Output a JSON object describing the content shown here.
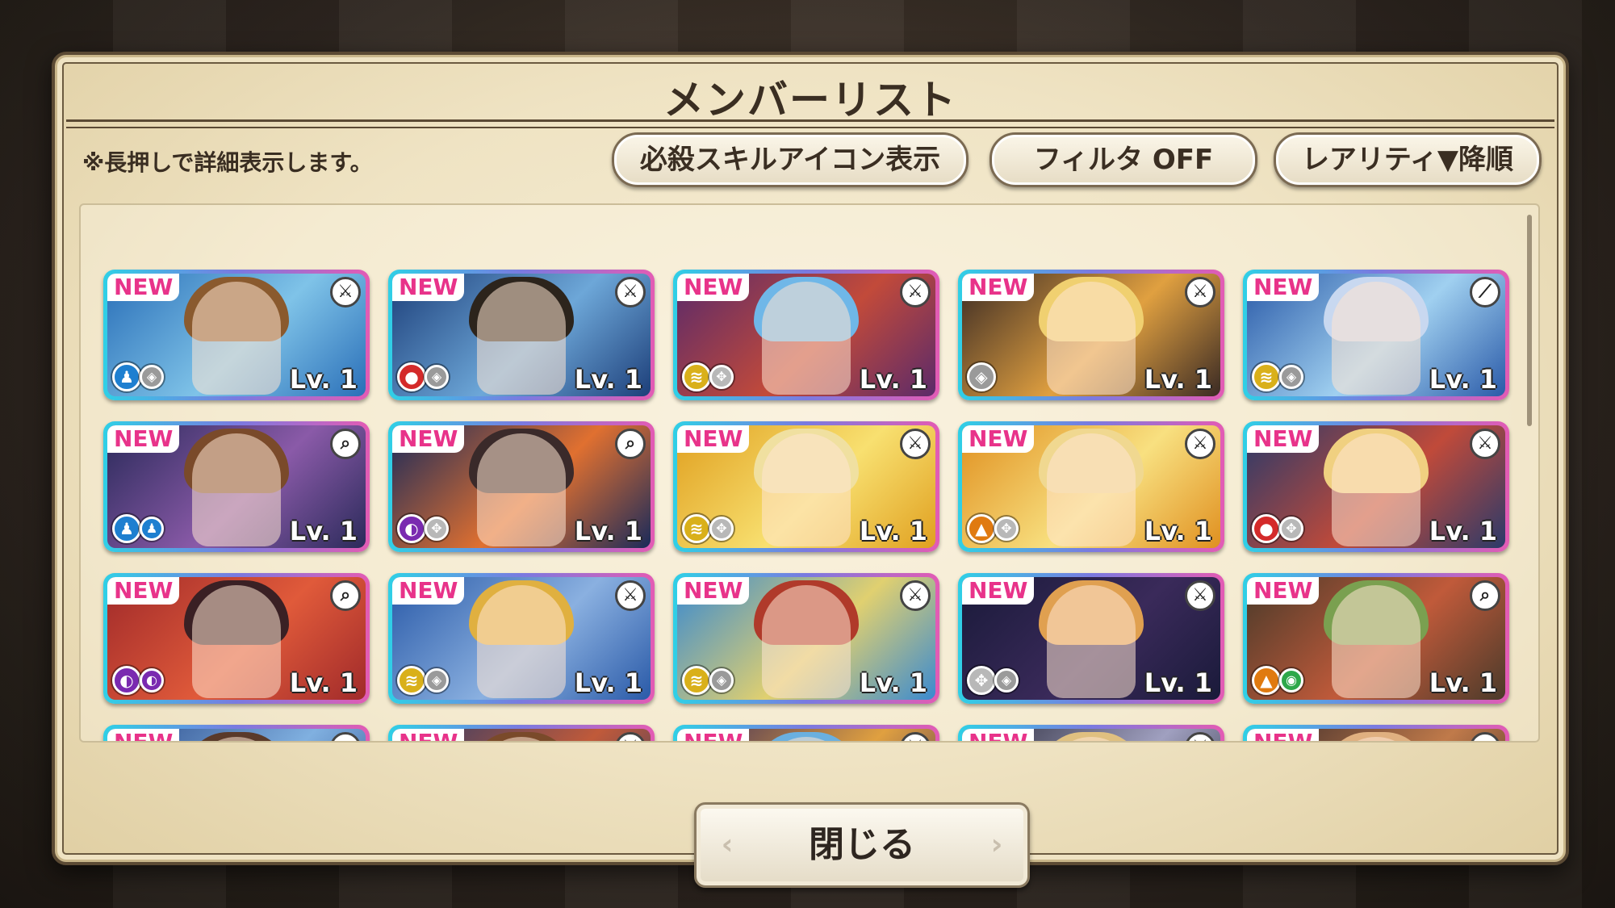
{
  "dialog": {
    "title": "メンバーリスト",
    "hint": "※長押しで詳細表示します。",
    "buttons": {
      "skill_icon_toggle": "必殺スキルアイコン表示",
      "filter": "フィルタ OFF",
      "sort": "レアリティ▼降順"
    },
    "close_label": "閉じる"
  },
  "cards": [
    {
      "badge": "NEW",
      "skill": "sword-icon",
      "elements": [
        "water-element",
        "neutral-element"
      ],
      "level": "Lv. 1",
      "palette": [
        "#2a6fb8",
        "#7fc3e8",
        "#8a5a2e"
      ]
    },
    {
      "badge": "NEW",
      "skill": "sword-icon",
      "elements": [
        "fire-element",
        "neutral-element"
      ],
      "level": "Lv. 1",
      "palette": [
        "#1d3f7a",
        "#6da7d8",
        "#2c241c"
      ]
    },
    {
      "badge": "NEW",
      "skill": "sword-icon",
      "elements": [
        "lightning-element",
        "wind-element"
      ],
      "level": "Lv. 1",
      "palette": [
        "#5a2a6a",
        "#c24a3a",
        "#6fb7e8"
      ]
    },
    {
      "badge": "NEW",
      "skill": "sword-icon",
      "elements": [
        "neutral-element"
      ],
      "level": "Lv. 1",
      "palette": [
        "#3a2a24",
        "#e0a040",
        "#f0d070"
      ]
    },
    {
      "badge": "NEW",
      "skill": "wand-icon",
      "elements": [
        "lightning-element",
        "neutral-element"
      ],
      "level": "Lv. 1",
      "palette": [
        "#2a5aa8",
        "#a0d0f0",
        "#c8d8f0"
      ]
    },
    {
      "badge": "NEW",
      "skill": "magnifier-icon",
      "elements": [
        "water-element",
        "water-element"
      ],
      "level": "Lv. 1",
      "palette": [
        "#2a2a5a",
        "#8a5aa8",
        "#7a4a2a"
      ]
    },
    {
      "badge": "NEW",
      "skill": "magnifier-icon",
      "elements": [
        "dark-element",
        "wind-element"
      ],
      "level": "Lv. 1",
      "palette": [
        "#1a2a5a",
        "#e07030",
        "#3a2a2a"
      ]
    },
    {
      "badge": "NEW",
      "skill": "sword-icon",
      "elements": [
        "lightning-element",
        "wind-element"
      ],
      "level": "Lv. 1",
      "palette": [
        "#e0a020",
        "#f8e070",
        "#f0e0a0"
      ]
    },
    {
      "badge": "NEW",
      "skill": "sword-icon",
      "elements": [
        "earth-element",
        "wind-element"
      ],
      "level": "Lv. 1",
      "palette": [
        "#e09020",
        "#f8e080",
        "#f0d890"
      ]
    },
    {
      "badge": "NEW",
      "skill": "sword-icon",
      "elements": [
        "fire-element",
        "wind-element"
      ],
      "level": "Lv. 1",
      "palette": [
        "#2a3a6a",
        "#c04a3a",
        "#f0d080"
      ]
    },
    {
      "badge": "NEW",
      "skill": "magnifier-icon",
      "elements": [
        "dark-element",
        "dark-element"
      ],
      "level": "Lv. 1",
      "palette": [
        "#a02a2a",
        "#e05a3a",
        "#3a2024"
      ]
    },
    {
      "badge": "NEW",
      "skill": "sword-icon",
      "elements": [
        "lightning-element",
        "neutral-element"
      ],
      "level": "Lv. 1",
      "palette": [
        "#2a5aa8",
        "#8ab0e0",
        "#e0b040"
      ]
    },
    {
      "badge": "NEW",
      "skill": "sword-icon",
      "elements": [
        "lightning-element",
        "neutral-element"
      ],
      "level": "Lv. 1",
      "palette": [
        "#3a8ad0",
        "#e0d070",
        "#b03a2a"
      ]
    },
    {
      "badge": "NEW",
      "skill": "sword-icon",
      "elements": [
        "wind-element",
        "neutral-element"
      ],
      "level": "Lv. 1",
      "palette": [
        "#1a1a3a",
        "#3a2a5a",
        "#e0a050"
      ]
    },
    {
      "badge": "NEW",
      "skill": "magnifier-icon",
      "elements": [
        "earth-element",
        "wind-green-element"
      ],
      "level": "Lv. 1",
      "palette": [
        "#4a3a2a",
        "#c05a3a",
        "#7aa050"
      ]
    },
    {
      "badge": "NEW",
      "skill": "magnifier-icon",
      "elements": [
        "water-element"
      ],
      "level": "",
      "palette": [
        "#2a4a8a",
        "#80b0e0",
        "#5a3a2a"
      ]
    },
    {
      "badge": "NEW",
      "skill": "sword-icon",
      "elements": [
        "fire-element"
      ],
      "level": "",
      "palette": [
        "#2a3a6a",
        "#c05a3a",
        "#7a4a2a"
      ]
    },
    {
      "badge": "NEW",
      "skill": "sword-icon",
      "elements": [
        "lightning-element"
      ],
      "level": "",
      "palette": [
        "#3a2a5a",
        "#e0a040",
        "#6ab0e0"
      ]
    },
    {
      "badge": "NEW",
      "skill": "sword-icon",
      "elements": [
        "neutral-element"
      ],
      "level": "",
      "palette": [
        "#2a2a3a",
        "#a0a0c0",
        "#e0c080"
      ]
    },
    {
      "badge": "NEW",
      "skill": "magnifier-icon",
      "elements": [
        "earth-element"
      ],
      "level": "",
      "palette": [
        "#3a2a2a",
        "#c07a4a",
        "#e0b080"
      ]
    }
  ],
  "icon_glyphs": {
    "sword-icon": "⚔",
    "wand-icon": "⟋",
    "magnifier-icon": "⌕"
  },
  "element_colors": {
    "water-element": "#1e7fd0",
    "fire-element": "#d42a2a",
    "lightning-element": "#d9b01a",
    "neutral-element": "#9a9a9a",
    "wind-element": "#b8b8b8",
    "dark-element": "#7a2ab0",
    "earth-element": "#e07a10",
    "wind-green-element": "#2ea84a"
  },
  "element_glyphs": {
    "water-element": "♟",
    "fire-element": "●",
    "lightning-element": "≋",
    "neutral-element": "◈",
    "wind-element": "✥",
    "dark-element": "◐",
    "earth-element": "▲",
    "wind-green-element": "◉"
  }
}
